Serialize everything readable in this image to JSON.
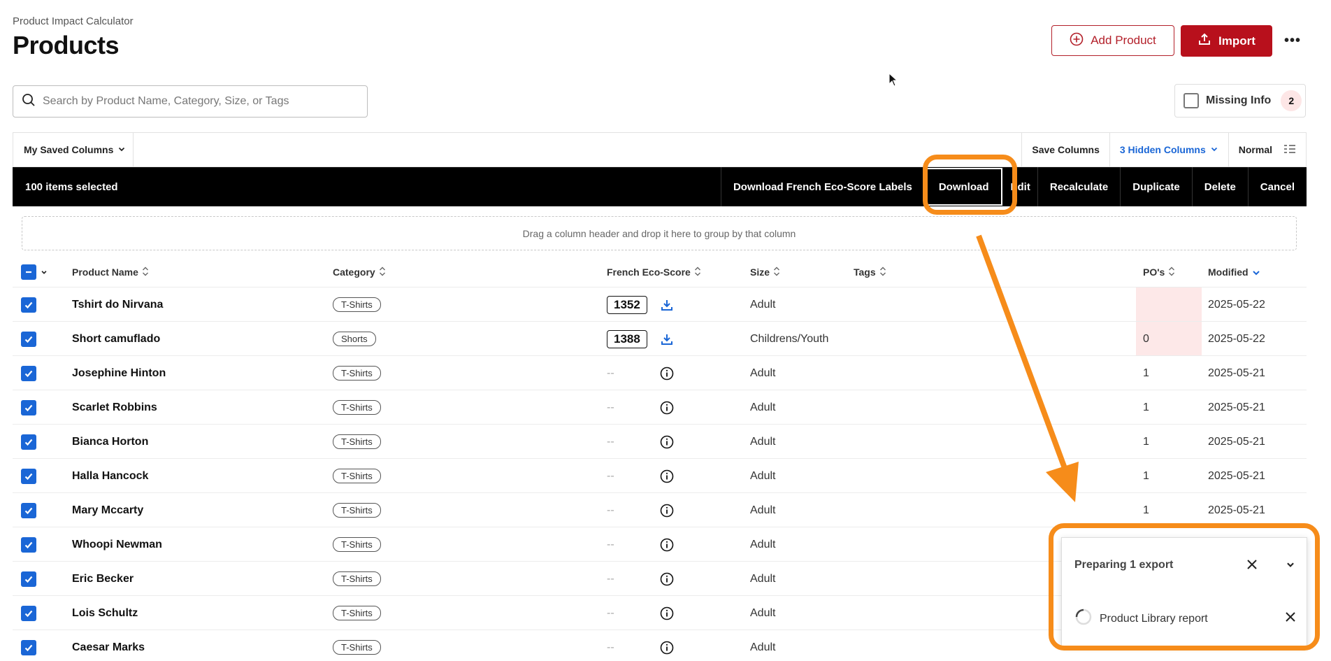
{
  "header": {
    "app_name": "Product Impact Calculator",
    "page_title": "Products",
    "add_product_label": "Add Product",
    "import_label": "Import",
    "more_label": "•••"
  },
  "search": {
    "placeholder": "Search by Product Name, Category, Size, or Tags",
    "value": ""
  },
  "missing_info": {
    "label": "Missing Info",
    "count": "2",
    "checked": false
  },
  "toolbar": {
    "saved_columns_label": "My Saved Columns",
    "save_columns_label": "Save Columns",
    "hidden_columns_label": "3 Hidden Columns",
    "density_label": "Normal"
  },
  "selection_bar": {
    "count_label": "100 items selected",
    "actions": {
      "download_labels": "Download French Eco-Score Labels",
      "download": "Download",
      "edit": "Edit",
      "recalculate": "Recalculate",
      "duplicate": "Duplicate",
      "delete": "Delete",
      "cancel": "Cancel"
    }
  },
  "group_zone_text": "Drag a column header and drop it here to group by that column",
  "columns": {
    "name": "Product Name",
    "category": "Category",
    "eco": "French Eco-Score",
    "size": "Size",
    "tags": "Tags",
    "po": "PO's",
    "modified": "Modified"
  },
  "rows": [
    {
      "name": "Tshirt do Nirvana",
      "category": "T-Shirts",
      "eco": "1352",
      "size": "Adult",
      "tags": "",
      "po": "",
      "modified": "2025-05-22"
    },
    {
      "name": "Short camuflado",
      "category": "Shorts",
      "eco": "1388",
      "size": "Childrens/Youth",
      "tags": "",
      "po": "0",
      "modified": "2025-05-22"
    },
    {
      "name": "Josephine Hinton",
      "category": "T-Shirts",
      "eco": "--",
      "size": "Adult",
      "tags": "",
      "po": "1",
      "modified": "2025-05-21"
    },
    {
      "name": "Scarlet Robbins",
      "category": "T-Shirts",
      "eco": "--",
      "size": "Adult",
      "tags": "",
      "po": "1",
      "modified": "2025-05-21"
    },
    {
      "name": "Bianca Horton",
      "category": "T-Shirts",
      "eco": "--",
      "size": "Adult",
      "tags": "",
      "po": "1",
      "modified": "2025-05-21"
    },
    {
      "name": "Halla Hancock",
      "category": "T-Shirts",
      "eco": "--",
      "size": "Adult",
      "tags": "",
      "po": "1",
      "modified": "2025-05-21"
    },
    {
      "name": "Mary Mccarty",
      "category": "T-Shirts",
      "eco": "--",
      "size": "Adult",
      "tags": "",
      "po": "1",
      "modified": "2025-05-21"
    },
    {
      "name": "Whoopi Newman",
      "category": "T-Shirts",
      "eco": "--",
      "size": "Adult",
      "tags": "",
      "po": "",
      "modified": ""
    },
    {
      "name": "Eric Becker",
      "category": "T-Shirts",
      "eco": "--",
      "size": "Adult",
      "tags": "",
      "po": "",
      "modified": ""
    },
    {
      "name": "Lois Schultz",
      "category": "T-Shirts",
      "eco": "--",
      "size": "Adult",
      "tags": "",
      "po": "",
      "modified": ""
    },
    {
      "name": "Caesar Marks",
      "category": "T-Shirts",
      "eco": "--",
      "size": "Adult",
      "tags": "",
      "po": "",
      "modified": ""
    }
  ],
  "export_panel": {
    "title": "Preparing 1 export",
    "item_label": "Product Library report"
  },
  "colors": {
    "brand_red": "#b8101c",
    "accent_blue": "#1a66d6",
    "annotation_orange": "#f68c1a",
    "selection_bar": "#000000",
    "po_highlight": "#fde8e8"
  },
  "icons": {
    "add": "plus-circle-icon",
    "import": "upload-icon",
    "search": "search-icon",
    "eco_download": "download-icon",
    "eco_missing": "info-icon",
    "sort": "sort-icon",
    "sort_desc": "sort-desc-icon",
    "density": "density-icon",
    "close": "close-icon",
    "spinner": "spinner-icon"
  }
}
